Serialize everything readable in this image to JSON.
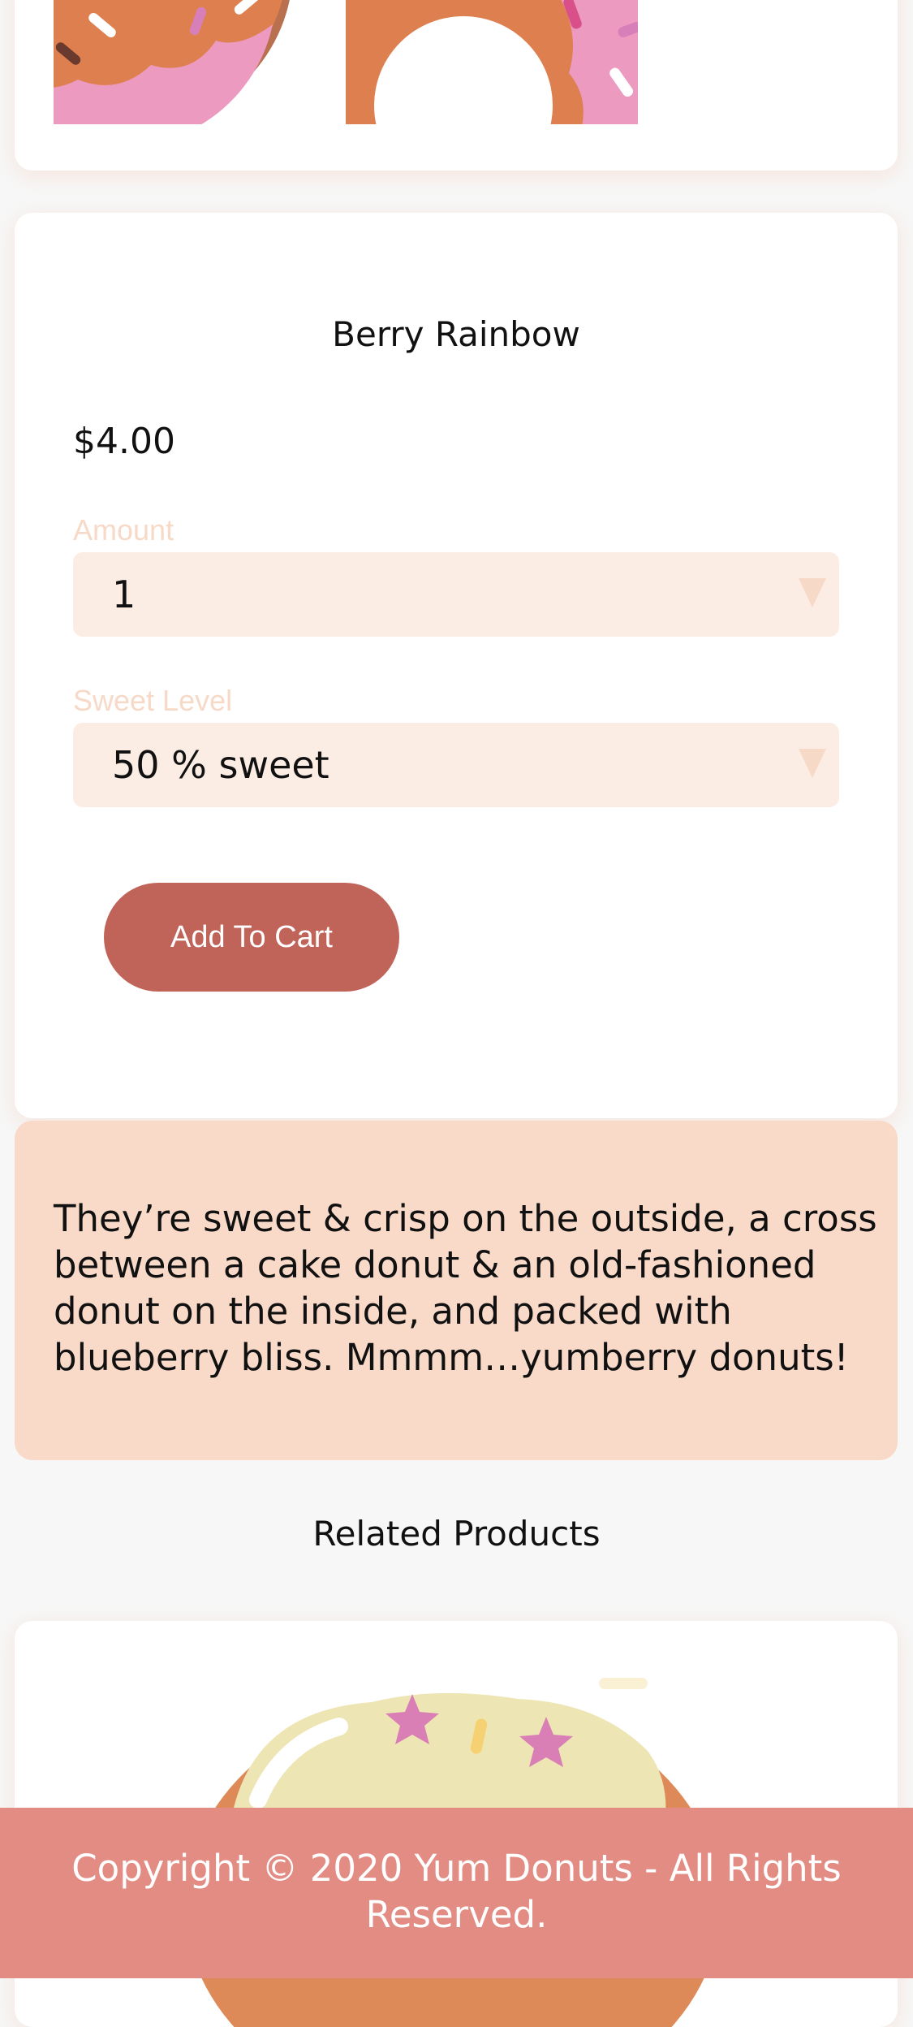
{
  "product": {
    "name": "Berry Rainbow",
    "price": "$4.00",
    "amount_label": "Amount",
    "amount_value": "1",
    "sweet_label": "Sweet Level",
    "sweet_value": "50 % sweet",
    "add_to_cart_label": "Add To Cart",
    "description": "They’re sweet & crisp on the outside, a cross between a cake donut & an old-fashioned donut on the inside, and packed with blueberry bliss. Mmmm…yumberry donuts!"
  },
  "related": {
    "title": "Related Products"
  },
  "footer": {
    "copyright": "Copyright © 2020 Yum Donuts - All Rights Reserved."
  },
  "colors": {
    "accent_button": "#c0645a",
    "footer_bg": "#e28c84",
    "description_bg": "#f9dac9",
    "select_bg": "#fcede4",
    "label_color": "#f7d9c8"
  }
}
